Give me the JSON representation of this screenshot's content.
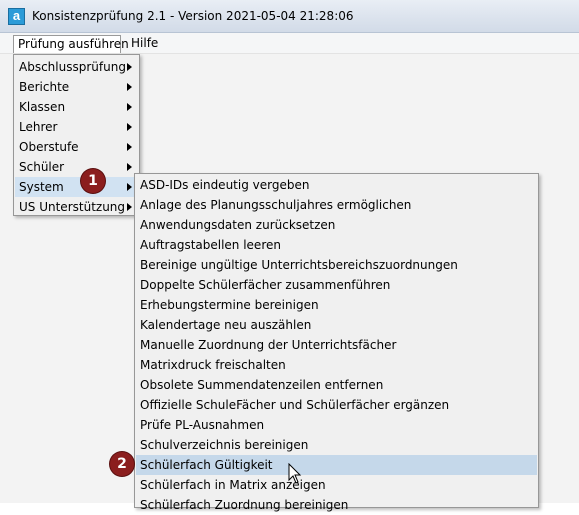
{
  "window": {
    "title": "Konsistenzprüfung 2.1 - Version 2021-05-04 21:28:06",
    "app_icon_letter": "a"
  },
  "menubar": {
    "items": [
      {
        "label": "Prüfung ausführen"
      },
      {
        "label": "Hilfe"
      }
    ]
  },
  "main_menu": {
    "items": [
      {
        "label": "Abschlussprüfung"
      },
      {
        "label": "Berichte"
      },
      {
        "label": "Klassen"
      },
      {
        "label": "Lehrer"
      },
      {
        "label": "Oberstufe"
      },
      {
        "label": "Schüler"
      },
      {
        "label": "System"
      },
      {
        "label": "US Unterstützung"
      }
    ]
  },
  "system_menu": {
    "items": [
      {
        "label": "ASD-IDs eindeutig vergeben"
      },
      {
        "label": "Anlage des Planungsschuljahres ermöglichen"
      },
      {
        "label": "Anwendungsdaten zurücksetzen"
      },
      {
        "label": "Auftragstabellen leeren"
      },
      {
        "label": "Bereinige ungültige Unterrichtsbereichszuordnungen"
      },
      {
        "label": "Doppelte Schülerfächer zusammenführen"
      },
      {
        "label": "Erhebungstermine bereinigen"
      },
      {
        "label": "Kalendertage neu auszählen"
      },
      {
        "label": "Manuelle Zuordnung der Unterrichtsfächer"
      },
      {
        "label": "Matrixdruck freischalten"
      },
      {
        "label": "Obsolete Summendatenzeilen entfernen"
      },
      {
        "label": "Offizielle SchuleFächer und Schülerfächer ergänzen"
      },
      {
        "label": "Prüfe PL-Ausnahmen"
      },
      {
        "label": "Schulverzeichnis bereinigen"
      },
      {
        "label": "Schülerfach Gültigkeit"
      },
      {
        "label": "Schülerfach in Matrix anzeigen"
      },
      {
        "label": "Schülerfach Zuordnung bereinigen"
      }
    ]
  },
  "annotations": {
    "step1": "1",
    "step2": "2"
  },
  "colors": {
    "highlight": "#d1e2f2",
    "badge": "#8b1e1e"
  }
}
